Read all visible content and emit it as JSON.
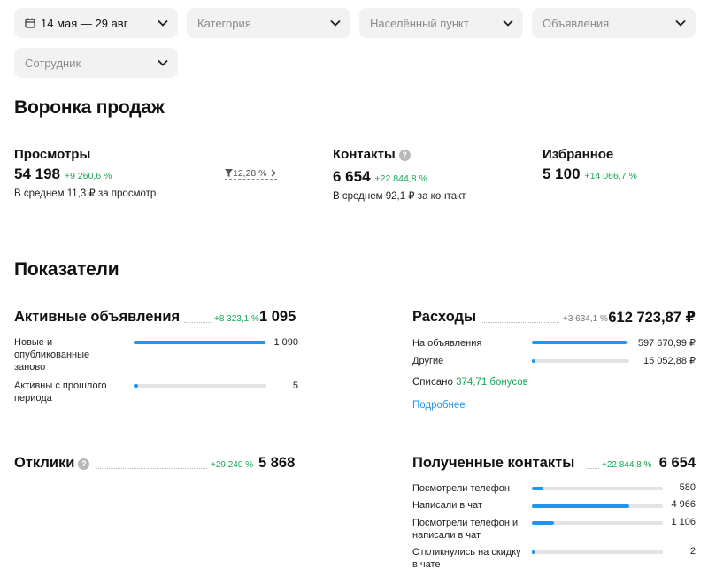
{
  "filters": {
    "date": "14 мая — 29 авг",
    "category": "Категория",
    "locality": "Населённый пункт",
    "ads": "Объявления",
    "employee": "Сотрудник"
  },
  "funnel": {
    "title": "Воронка продаж",
    "views": {
      "label": "Просмотры",
      "value": "54 198",
      "delta": "+9 260,6 %",
      "avg": "В среднем 11,3 ₽ за просмотр"
    },
    "conversion": "12,28 %",
    "contacts": {
      "label": "Контакты",
      "value": "6 654",
      "delta": "+22 844,8 %",
      "avg": "В среднем 92,1 ₽ за контакт"
    },
    "favorites": {
      "label": "Избранное",
      "value": "5 100",
      "delta": "+14 066,7 %"
    }
  },
  "indicators": {
    "title": "Показатели",
    "active_ads": {
      "title": "Активные объявления",
      "delta": "+8 323,1 %",
      "total": "1 095",
      "rows": [
        {
          "label": "Новые и опубликованные заново",
          "value": "1 090",
          "fraction": 0.995
        },
        {
          "label": "Активны с прошлого периода",
          "value": "5",
          "fraction": 0.03
        }
      ]
    },
    "expenses": {
      "title": "Расходы",
      "delta": "+3 634,1 %",
      "total": "612 723,87 ₽",
      "rows": [
        {
          "label": "На объявления",
          "value": "597 670,99 ₽",
          "fraction": 0.975
        },
        {
          "label": "Другие",
          "value": "15 052,88 ₽",
          "fraction": 0.03
        }
      ],
      "written_off_label": "Списано",
      "written_off_value": "374,71 бонусов",
      "more_link": "Подробнее"
    },
    "responses": {
      "title": "Отклики",
      "delta": "+29 240 %",
      "total": "5 868"
    },
    "received_contacts": {
      "title": "Полученные контакты",
      "delta": "+22 844,8 %",
      "total": "6 654",
      "rows": [
        {
          "label": "Посмотрели телефон",
          "value": "580",
          "fraction": 0.087
        },
        {
          "label": "Написали в чат",
          "value": "4 966",
          "fraction": 0.746
        },
        {
          "label": "Посмотрели телефон и написали в чат",
          "value": "1 106",
          "fraction": 0.166
        },
        {
          "label": "Откликнулись на скидку в чате",
          "value": "2",
          "fraction": 0.02
        }
      ]
    }
  }
}
